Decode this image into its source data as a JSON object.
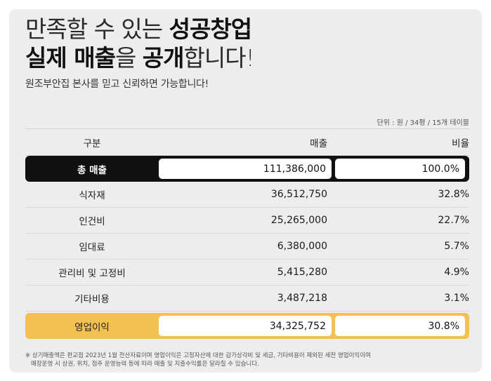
{
  "headline": {
    "line1_light": "만족할 수 있는 ",
    "line1_bold": "성공창업",
    "line2_bold1": "실제 매출",
    "line2_light1": "을 ",
    "line2_bold2": "공개",
    "line2_light2": "합니다!"
  },
  "subtitle": "원조부안집 본사를 믿고 신뢰하면 가능합니다!",
  "unit_note": "단위 : 원 / 34평 / 15개 테이블",
  "table": {
    "headers": {
      "category": "구분",
      "sales": "매출",
      "ratio": "비율"
    },
    "total": {
      "category": "총 매출",
      "sales": "111,386,000",
      "ratio": "100.0%"
    },
    "rows": [
      {
        "category": "식자재",
        "sales": "36,512,750",
        "ratio": "32.8%"
      },
      {
        "category": "인건비",
        "sales": "25,265,000",
        "ratio": "22.7%"
      },
      {
        "category": "임대료",
        "sales": "6,380,000",
        "ratio": "5.7%"
      },
      {
        "category": "관리비 및 고정비",
        "sales": "5,415,280",
        "ratio": "4.9%"
      },
      {
        "category": "기타비용",
        "sales": "3,487,218",
        "ratio": "3.1%"
      }
    ],
    "profit": {
      "category": "영업이익",
      "sales": "34,325,752",
      "ratio": "30.8%"
    }
  },
  "footnote": {
    "line1": "※ 상기매출액은 판교점 2023년 1월 전산자료이며 영업이익은 고정자산에 대한 감가상각비 및 세금, 기타비용이 제외된 세전 영업이익이며",
    "line2": "매장운영 시 상권, 위치, 점주 운영능력 등에 따라 매출 및 지출수익률은 달라질 수 있습니다."
  },
  "colors": {
    "total_bg": "#111111",
    "profit_bg": "#f2c152",
    "card_bg": "#ededed"
  }
}
